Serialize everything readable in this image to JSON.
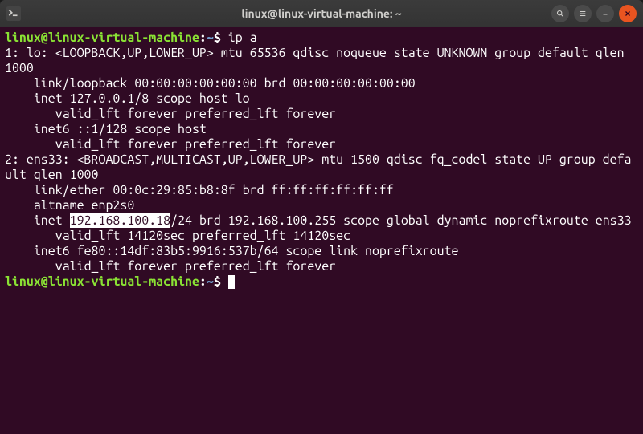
{
  "titlebar": {
    "title": "linux@linux-virtual-machine: ~",
    "icons": {
      "search": "search-icon",
      "menu": "hamburger-icon",
      "minimize": "minimize-icon",
      "close": "close-icon"
    }
  },
  "prompt": {
    "user_host": "linux@linux-virtual-machine",
    "separator": ":",
    "path": "~",
    "symbol": "$"
  },
  "command1": "ip a",
  "output": {
    "l1": "1: lo: <LOOPBACK,UP,LOWER_UP> mtu 65536 qdisc noqueue state UNKNOWN group default qlen 1000",
    "l2": "    link/loopback 00:00:00:00:00:00 brd 00:00:00:00:00:00",
    "l3": "    inet 127.0.0.1/8 scope host lo",
    "l4": "       valid_lft forever preferred_lft forever",
    "l5": "    inet6 ::1/128 scope host ",
    "l6": "       valid_lft forever preferred_lft forever",
    "l7": "2: ens33: <BROADCAST,MULTICAST,UP,LOWER_UP> mtu 1500 qdisc fq_codel state UP group default qlen 1000",
    "l8": "    link/ether 00:0c:29:85:b8:8f brd ff:ff:ff:ff:ff:ff",
    "l9": "    altname enp2s0",
    "l10a": "    inet ",
    "l10_hl": "192.168.100.18",
    "l10b": "/24 brd 192.168.100.255 scope global dynamic noprefixroute ens33",
    "l11": "       valid_lft 14120sec preferred_lft 14120sec",
    "l12": "    inet6 fe80::14df:83b5:9916:537b/64 scope link noprefixroute ",
    "l13": "       valid_lft forever preferred_lft forever"
  },
  "command2": ""
}
